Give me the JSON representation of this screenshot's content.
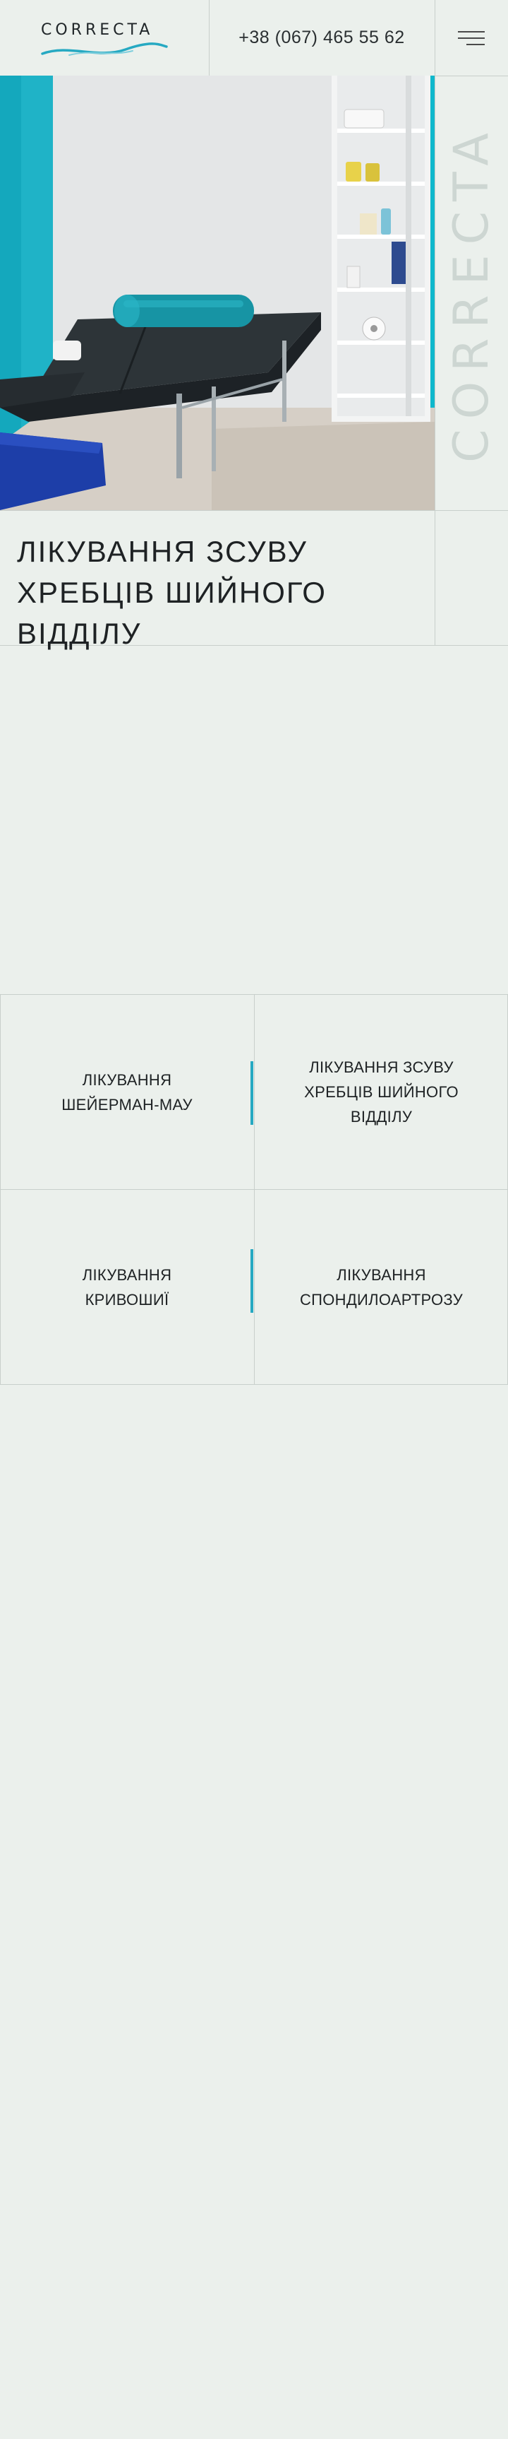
{
  "header": {
    "logo_text": "CORRECTA",
    "phone": "+38 (067) 465 55 62"
  },
  "side_brand": "CORRECTA",
  "page": {
    "title": "ЛІКУВАННЯ ЗСУВУ ХРЕБЦІВ ШИЙНОГО ВІДДІЛУ"
  },
  "links": [
    {
      "label": "ЛІКУВАННЯ\nШЕЙЕРМАН-МАУ"
    },
    {
      "label": "ЛІКУВАННЯ ЗСУВУ\nХРЕБЦІВ ШИЙНОГО\nВІДДІЛУ"
    },
    {
      "label": "ЛІКУВАННЯ\nКРИВОШИЇ"
    },
    {
      "label": "ЛІКУВАННЯ\nСПОНДИЛОАРТРОЗУ"
    }
  ],
  "colors": {
    "background": "#ebf0ec",
    "accent": "#26a9c2",
    "lines": "#c8cfcb"
  },
  "icons": {
    "menu": "hamburger-menu-icon",
    "logo_mark": "wave-logo-icon"
  }
}
